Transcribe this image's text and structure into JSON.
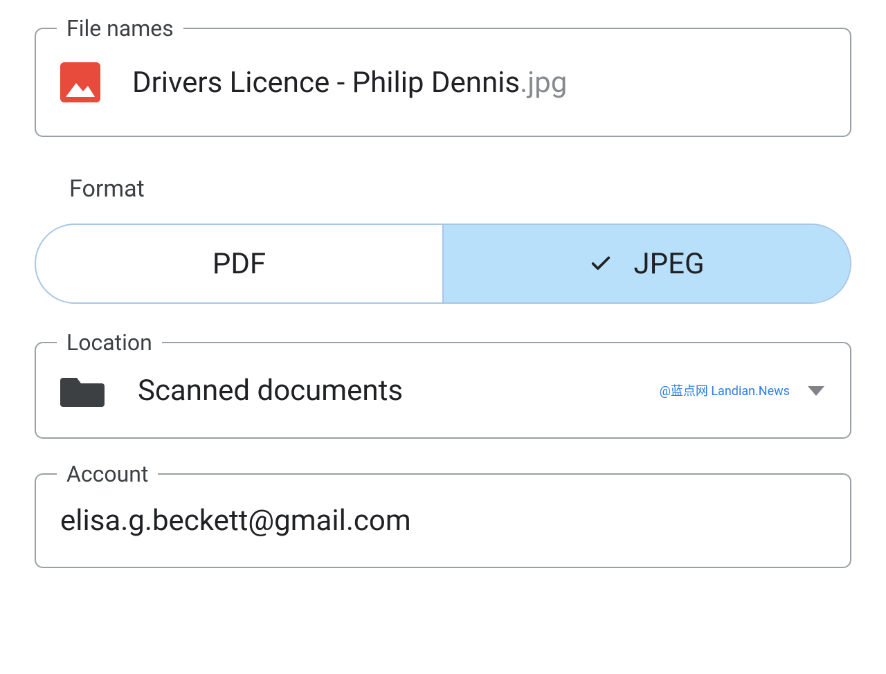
{
  "fileNames": {
    "legend": "File names",
    "iconName": "image-icon",
    "name_base": "Drivers Licence - Philip Dennis",
    "name_ext": ".jpg"
  },
  "format": {
    "label": "Format",
    "options": {
      "pdf": "PDF",
      "jpeg": "JPEG"
    },
    "selected": "jpeg"
  },
  "location": {
    "legend": "Location",
    "folder": "Scanned documents",
    "watermark": "@蓝点网 Landian.News"
  },
  "account": {
    "legend": "Account",
    "email": "elisa.g.beckett@gmail.com"
  },
  "colors": {
    "border": "#9aa0a6",
    "segmentBorder": "#a7c7e7",
    "selectedBg": "#b9e0fb",
    "imageIconBg": "#e84a3b",
    "folderIcon": "#3c4043",
    "caret": "#808388",
    "watermark": "#2a7de1"
  }
}
